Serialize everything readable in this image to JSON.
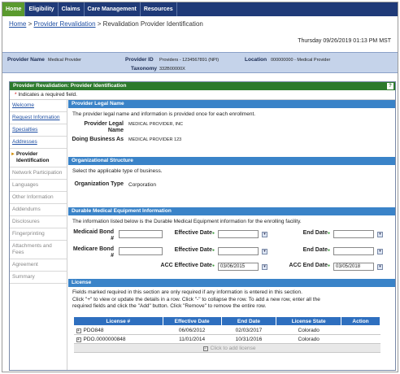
{
  "nav": {
    "tabs": [
      "Home",
      "Eligibility",
      "Claims",
      "Care Management",
      "Resources"
    ]
  },
  "breadcrumb": {
    "home": "Home",
    "sep1": ">",
    "revalidation": "Provider Revalidation",
    "sep2": ">",
    "current": "Revalidation Provider Identification"
  },
  "datetime": "Thursday 09/26/2019 01:13 PM MST",
  "info": {
    "provider_name_label": "Provider Name",
    "provider_name": "Medical Provider",
    "provider_id_label": "Provider ID",
    "provider_id": "Providers - 1234567891 (NPI)",
    "location_label": "Location",
    "location": "000000000 - Medical Provider",
    "taxonomy_label": "Taxonomy",
    "taxonomy": "332B00000X"
  },
  "panel": {
    "title": "Provider Revalidation: Provider Identification",
    "help": "?",
    "required_note": "Indicates a required field."
  },
  "sidebar": [
    "Welcome",
    "Request Information",
    "Specialties",
    "Addresses",
    "Provider Identification",
    "Network Participation",
    "Languages",
    "Other Information",
    "Addendums",
    "Disclosures",
    "Fingerprinting",
    "Attachments and Fees",
    "Agreement",
    "Summary"
  ],
  "legal": {
    "header": "Provider Legal Name",
    "intro": "The provider legal name and information is provided once for each enrollment.",
    "legal_name_label": "Provider Legal Name",
    "legal_name": "MEDICAL PROVIDER, INC",
    "dba_label": "Doing Business As",
    "dba": "MEDICAL PROVIDER 123"
  },
  "org": {
    "header": "Organizational Structure",
    "intro": "Select the applicable type of business.",
    "type_label": "Organization Type",
    "type": "Corporation"
  },
  "dme": {
    "header": "Durable Medical Equipment Information",
    "intro": "The information listed below is the Durable Medical Equipment information for the enrolling facility.",
    "medicaid_label": "Medicaid Bond #",
    "medicare_label": "Medicare Bond #",
    "eff_label": "Effective Date",
    "end_label": "End Date",
    "acc_eff_label": "ACC Effective Date",
    "acc_eff": "03/06/2015",
    "acc_end_label": "ACC End Date",
    "acc_end": "03/05/2018"
  },
  "license": {
    "header": "License",
    "intro_1": "Fields marked required in this section are only required if any information is entered in this section.",
    "intro_2": "Click \"+\" to view or update the details in a row. Click \"-\" to collapse the row. To add a new row, enter all the",
    "intro_3": "required fields and click the \"Add\" button. Click \"Remove\" to remove the entire row.",
    "columns": [
      "License #",
      "Effective Date",
      "End Date",
      "License State",
      "Action"
    ],
    "rows": [
      {
        "license": "PDO848",
        "effective": "06/06/2012",
        "end": "02/03/2017",
        "state": "Colorado"
      },
      {
        "license": "PDO.0000000848",
        "effective": "11/01/2014",
        "end": "10/31/2016",
        "state": "Colorado"
      }
    ],
    "add_label": "Click to add license"
  }
}
